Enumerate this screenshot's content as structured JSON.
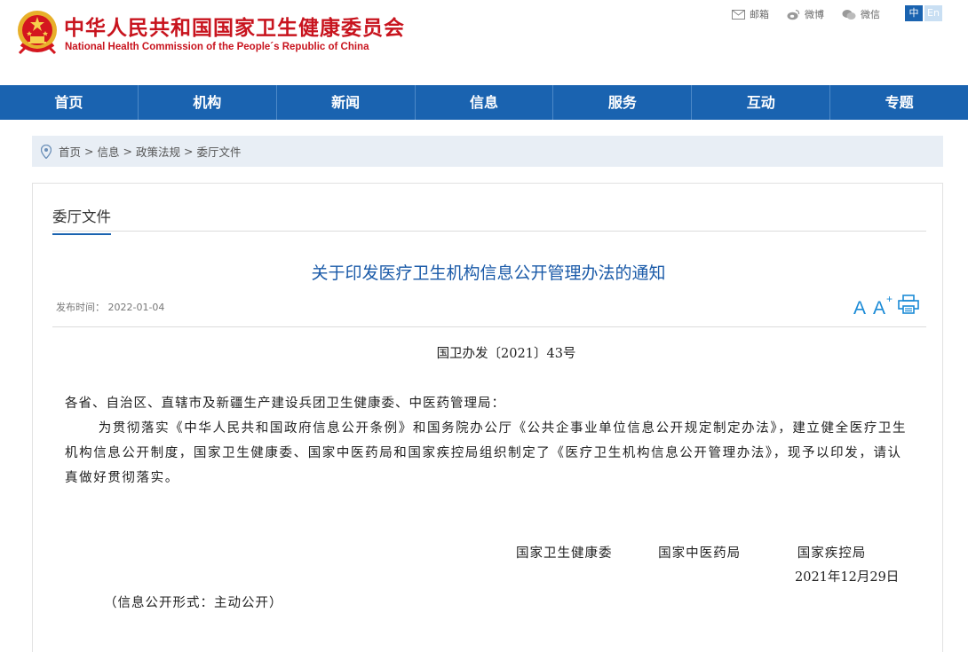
{
  "header": {
    "title_cn": "中华人民共和国国家卫生健康委员会",
    "title_en": "National Health Commission of the People´s Republic of China",
    "links": [
      {
        "label": "邮箱",
        "icon": "mail-icon"
      },
      {
        "label": "微博",
        "icon": "weibo-icon"
      },
      {
        "label": "微信",
        "icon": "wechat-icon"
      }
    ],
    "lang_cn": "中",
    "lang_en": "En",
    "brand_color": "#c8141e"
  },
  "nav": {
    "items": [
      "首页",
      "机构",
      "新闻",
      "信息",
      "服务",
      "互动",
      "专题"
    ],
    "color": "#1a63b0"
  },
  "breadcrumb": {
    "icon": "location-pin-icon",
    "items": [
      "首页",
      "信息",
      "政策法规",
      "委厅文件"
    ],
    "separator": ">"
  },
  "section": {
    "tab_label": "委厅文件"
  },
  "article": {
    "title": "关于印发医疗卫生机构信息公开管理办法的通知",
    "publish_label": "发布时间：",
    "publish_date": "2022-01-04",
    "tools": {
      "font_small": "A",
      "font_large": "A",
      "font_large_sup": "+",
      "print_icon": "print-icon"
    },
    "doc_number": "国卫办发〔2021〕43号",
    "recipients": "各省、自治区、直辖市及新疆生产建设兵团卫生健康委、中医药管理局：",
    "paragraph": "为贯彻落实《中华人民共和国政府信息公开条例》和国务院办公厅《公共企事业单位信息公开规定制定办法》，建立健全医疗卫生机构信息公开制度，国家卫生健康委、国家中医药局和国家疾控局组织制定了《医疗卫生机构信息公开管理办法》，现予以印发，请认真做好贯彻落实。",
    "signers": [
      "国家卫生健康委",
      "国家中医药局",
      "国家疾控局"
    ],
    "sign_date": "2021年12月29日",
    "disclosure": "（信息公开形式：主动公开）"
  }
}
